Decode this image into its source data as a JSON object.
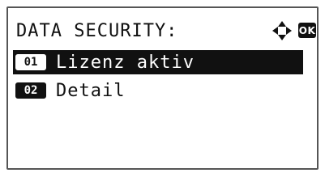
{
  "header": {
    "title": "DATA SECURITY:",
    "ok_label": "OK"
  },
  "menu": {
    "items": [
      {
        "number": "01",
        "label": "Lizenz aktiv",
        "selected": true
      },
      {
        "number": "02",
        "label": "Detail",
        "selected": false
      }
    ]
  },
  "icons": {
    "navigation": "four-way-arrow-icon"
  }
}
